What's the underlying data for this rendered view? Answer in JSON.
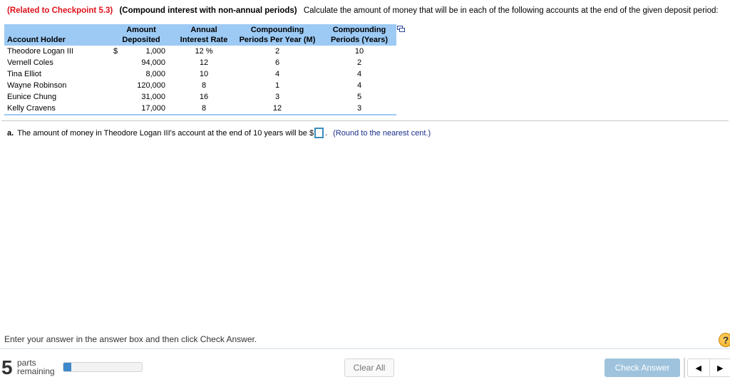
{
  "question": {
    "related": "(Related to Checkpoint 5.3)",
    "topic": "(Compound interest with non-annual periods)",
    "text": "Calculate the amount of money that will be in each of the following accounts at the end of the given deposit period:"
  },
  "table": {
    "headers": {
      "holder": [
        "",
        "Account Holder"
      ],
      "amount": [
        "Amount",
        "Deposited"
      ],
      "rate": [
        "Annual",
        "Interest Rate"
      ],
      "m": [
        "Compounding",
        "Periods Per Year (M)"
      ],
      "years": [
        "Compounding",
        "Periods (Years)"
      ]
    },
    "currency_symbol": "$",
    "rows": [
      {
        "holder": "Theodore Logan III",
        "amount": "1,000",
        "rate": "12 %",
        "m": "2",
        "years": "10"
      },
      {
        "holder": "Vernell Coles",
        "amount": "94,000",
        "rate": "12",
        "m": "6",
        "years": "2"
      },
      {
        "holder": "Tina Elliot",
        "amount": "8,000",
        "rate": "10",
        "m": "4",
        "years": "4"
      },
      {
        "holder": "Wayne Robinson",
        "amount": "120,000",
        "rate": "8",
        "m": "1",
        "years": "4"
      },
      {
        "holder": "Eunice Chung",
        "amount": "31,000",
        "rate": "16",
        "m": "3",
        "years": "5"
      },
      {
        "holder": "Kelly Cravens",
        "amount": "17,000",
        "rate": "8",
        "m": "12",
        "years": "3"
      }
    ],
    "copy_icon": "copy-data-icon"
  },
  "part_a": {
    "label": "a.",
    "text": "The amount of money in Theodore Logan III's account at the end of 10 years will be $",
    "answer_value": "",
    "after_box": ".",
    "hint": "(Round to the nearest cent.)"
  },
  "footer": {
    "instruction": "Enter your answer in the answer box and then click Check Answer.",
    "help_label": "?",
    "parts_count": "5",
    "parts_label_1": "parts",
    "parts_label_2": "remaining",
    "progress_fraction": 0.1,
    "clear_all": "Clear All",
    "check_answer": "Check Answer",
    "prev": "◀",
    "next": "▶"
  }
}
